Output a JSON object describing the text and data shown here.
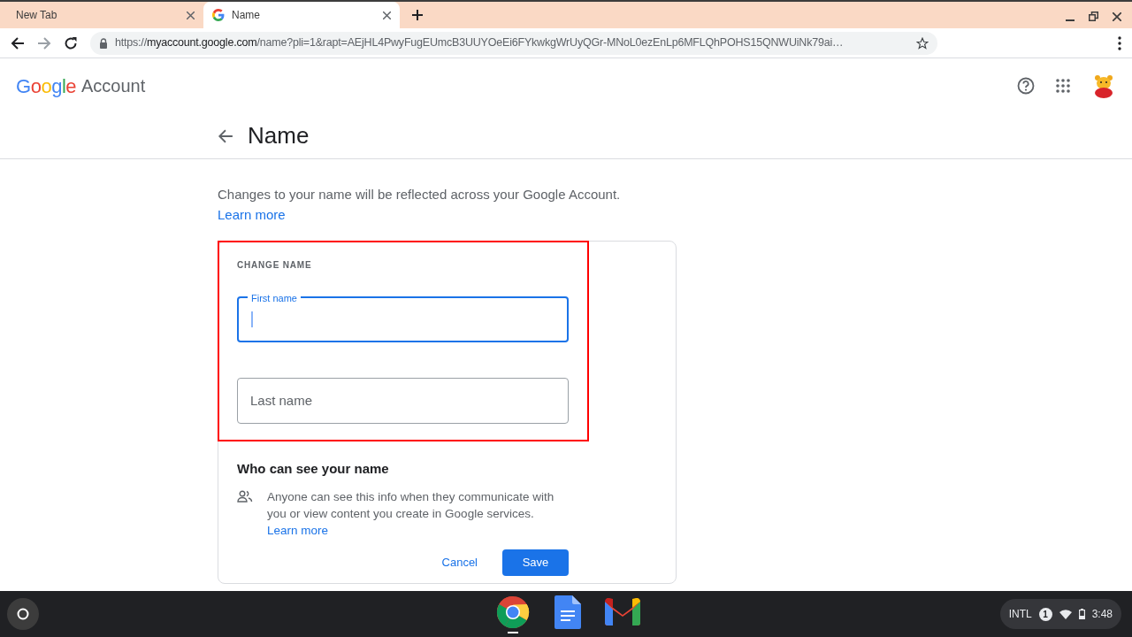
{
  "tabs": [
    {
      "title": "New Tab",
      "selected": false,
      "favicon": false
    },
    {
      "title": "Name",
      "selected": true,
      "favicon": true
    }
  ],
  "address_bar": {
    "scheme": "https://",
    "host": "myaccount.google.com",
    "path": "/name?pli=1&rapt=AEjHL4PwyFugEUmcB3UUYOeEi6FYkwkgWrUyQGr-MNoL0ezEnLp6MFLQhPOHS15QNWUiNk79ai…"
  },
  "header": {
    "logo": "Google",
    "product": "Account"
  },
  "page": {
    "title": "Name",
    "intro": "Changes to your name will be reflected across your Google Account.",
    "intro_link": "Learn more"
  },
  "change_name": {
    "heading": "CHANGE NAME",
    "highlighted": true,
    "fields": [
      {
        "label": "First name",
        "focused": true
      },
      {
        "placeholder": "Last name",
        "focused": false
      }
    ]
  },
  "visibility": {
    "heading": "Who can see your name",
    "text": "Anyone can see this info when they communicate with you or view content you create in Google services.",
    "link": "Learn more"
  },
  "buttons": [
    {
      "label": "Cancel",
      "kind": "text"
    },
    {
      "label": "Save",
      "kind": "filled"
    }
  ],
  "shelf": {
    "apps": [
      {
        "kind": "chrome",
        "open": true
      },
      {
        "kind": "docs",
        "open": false
      },
      {
        "kind": "gmail",
        "open": false
      }
    ],
    "status": {
      "ime": "INTL",
      "notifications": "1",
      "time": "3:48"
    }
  }
}
